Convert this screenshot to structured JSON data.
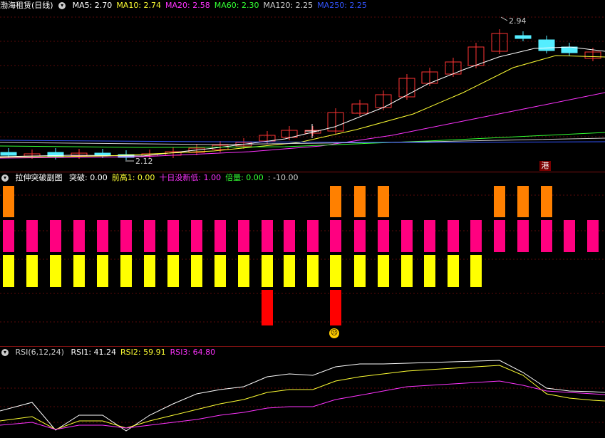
{
  "main_panel": {
    "title": "渤海租赁(日线)",
    "ma_items": [
      {
        "label": "MA5: 2.70",
        "color": "#ffffff"
      },
      {
        "label": "MA10: 2.74",
        "color": "#ffff33"
      },
      {
        "label": "MA20: 2.58",
        "color": "#ff33ff"
      },
      {
        "label": "MA60: 2.30",
        "color": "#33ff33"
      },
      {
        "label": "MA120: 2.25",
        "color": "#cccccc"
      },
      {
        "label": "MA250: 2.25",
        "color": "#3355ff"
      }
    ],
    "high_label": "2.94",
    "low_label": "2.12",
    "hk_marker": "港"
  },
  "indicator_panel": {
    "title": "拉伸突破副图",
    "items": [
      {
        "label": "突破: 0.00",
        "color": "#ffffff"
      },
      {
        "label": "前高1: 0.00",
        "color": "#ffff33"
      },
      {
        "label": "十日没新低: 1.00",
        "color": "#ff33ff"
      },
      {
        "label": "倍量: 0.00",
        "color": "#33ff33"
      },
      {
        "label": ": -10.00",
        "color": "#cccccc"
      }
    ],
    "face_icon": "☹"
  },
  "rsi_panel": {
    "title": "RSI(6,12,24)",
    "items": [
      {
        "label": "RSI1: 41.24",
        "color": "#ffffff"
      },
      {
        "label": "RSI2: 59.91",
        "color": "#ffff33"
      },
      {
        "label": "RSI3: 64.80",
        "color": "#ff33ff"
      }
    ]
  },
  "colors": {
    "up": "#ff3333",
    "down": "#55eeff",
    "orange": "#ff8000",
    "pink": "#ff0080",
    "yellow": "#ffff00",
    "red": "#ff0000"
  }
}
